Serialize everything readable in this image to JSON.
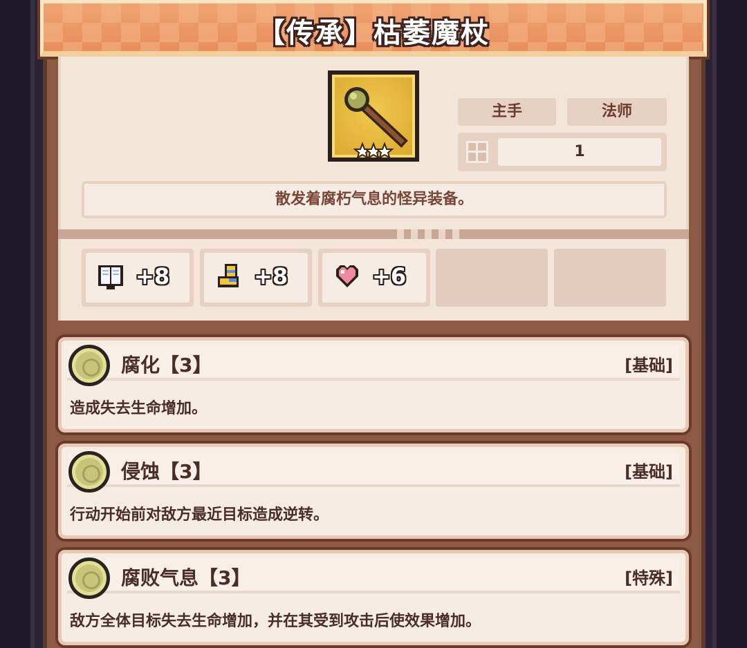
{
  "item": {
    "title": "【传承】枯萎魔杖",
    "slot_tag": "主手",
    "class_tag": "法师",
    "level_value": "1",
    "description": "散发着腐朽气息的怪异装备。",
    "stars": 3
  },
  "stats": [
    {
      "icon": "spellbook-icon",
      "value": "+8"
    },
    {
      "icon": "boot-icon",
      "value": "+8"
    },
    {
      "icon": "heart-icon",
      "value": "+6"
    }
  ],
  "skills": [
    {
      "name": "腐化【3】",
      "kind": "[基础]",
      "description": "造成失去生命增加。"
    },
    {
      "name": "侵蚀【3】",
      "kind": "[基础]",
      "description": "行动开始前对敌方最近目标造成逆转。"
    },
    {
      "name": "腐败气息【3】",
      "kind": "[特殊]",
      "description": "敌方全体目标失去生命增加，并在其受到攻击后使效果增加。"
    }
  ],
  "colors": {
    "banner": "#e88d5a",
    "card": "#f3e6d9",
    "text_brown": "#4a2d26",
    "item_bg": "#f0c94c"
  }
}
